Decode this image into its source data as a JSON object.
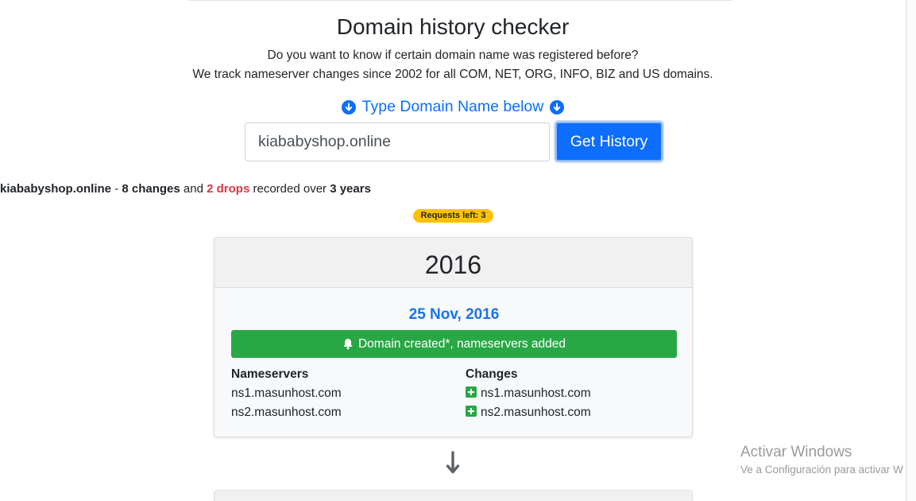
{
  "header": {
    "title": "Domain history checker",
    "subtitle_line1": "Do you want to know if certain domain name was registered before?",
    "subtitle_line2": "We track nameserver changes since 2002 for all COM, NET, ORG, INFO, BIZ and US domains."
  },
  "search": {
    "hint": "Type Domain Name below",
    "value": "kiababyshop.online",
    "button_label": "Get History"
  },
  "summary": {
    "domain": "kiababyshop.online",
    "sep": " - ",
    "changes": "8 changes",
    "and": " and ",
    "drops": "2 drops",
    "recorded_over": " recorded over ",
    "years": "3 years"
  },
  "badge": {
    "requests_left": "Requests left: 3"
  },
  "history": {
    "year": "2016",
    "entry": {
      "date": "25 Nov, 2016",
      "event": "Domain created*, nameservers added",
      "nameservers_label": "Nameservers",
      "changes_label": "Changes",
      "nameservers": [
        "ns1.masunhost.com",
        "ns2.masunhost.com"
      ],
      "changes": [
        "ns1.masunhost.com",
        "ns2.masunhost.com"
      ]
    }
  },
  "windows_watermark": {
    "title": "Activar Windows",
    "subtitle": "Ve a Configuración para activar W"
  },
  "icons": {
    "hint_left": "arrow-circle-down-icon",
    "hint_right": "arrow-circle-down-icon",
    "event": "bell-icon",
    "change": "plus-square-icon",
    "timeline": "arrow-down-icon"
  },
  "colors": {
    "primary": "#0d6efd",
    "success": "#28a745",
    "danger": "#dc3545",
    "warning": "#ffc107"
  }
}
